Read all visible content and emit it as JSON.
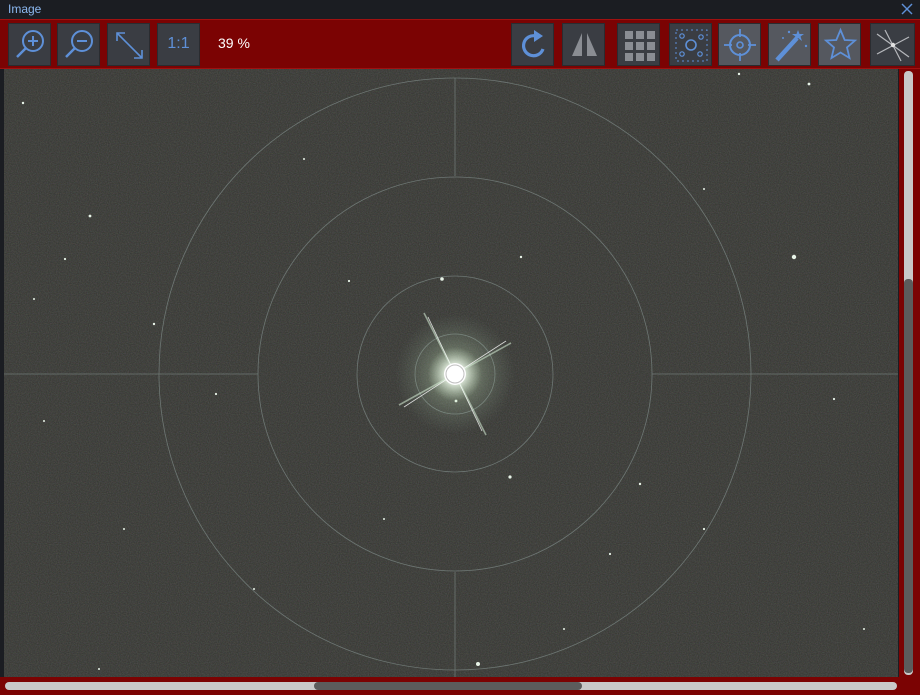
{
  "window": {
    "title": "Image"
  },
  "toolbar": {
    "ratio_label": "1:1",
    "zoom_level": "39 %"
  },
  "icons": {
    "zoom_in": "zoom-in-icon",
    "zoom_out": "zoom-out-icon",
    "fit": "fit-to-window-icon",
    "rotate": "rotate-icon",
    "flip": "flip-icon",
    "grid": "grid-icon",
    "star_detection": "star-detection-icon",
    "crosshair": "crosshair-icon",
    "stretch": "auto-stretch-icon",
    "bahtinov": "bahtinov-icon",
    "annotation": "annotation-icon"
  },
  "colors": {
    "toolbar_bg": "#7b0303",
    "accent": "#5e90d8",
    "button_bg": "#3a3d43",
    "sky_bg": "#33342f"
  }
}
